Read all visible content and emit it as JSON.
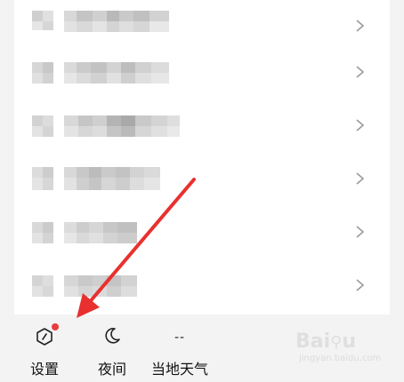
{
  "bottom_bar": {
    "settings": {
      "label": "设置",
      "icon": "hexagon-settings-icon",
      "badge_color": "#ea3c3c"
    },
    "night": {
      "label": "夜间",
      "icon": "moon-icon"
    },
    "weather": {
      "label": "当地天气",
      "temp": "--"
    }
  },
  "list": {
    "rows": 6
  },
  "annotation": {
    "arrow_color": "#e8312f"
  },
  "watermark": {
    "text": "Baidu",
    "sub": "jingyan.baidu.com"
  }
}
